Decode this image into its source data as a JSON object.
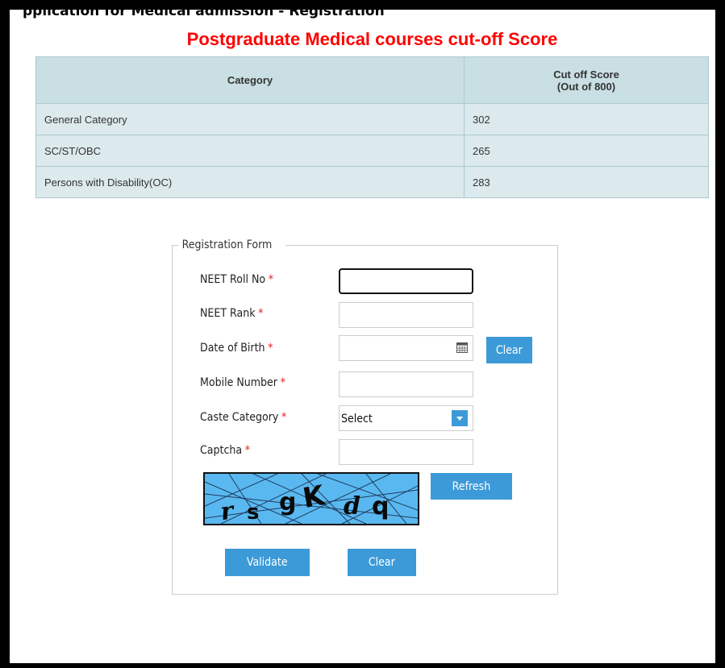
{
  "header": {
    "cropped_title": "pplication for Medical admission - Registration"
  },
  "page_title": "Postgraduate Medical courses cut-off Score",
  "cutoff_table": {
    "headers": {
      "category": "Category",
      "score_line1": "Cut off Score",
      "score_line2": "(Out of 800)"
    },
    "rows": [
      {
        "category": "General Category",
        "score": "302"
      },
      {
        "category": "SC/ST/OBC",
        "score": "265"
      },
      {
        "category": "Persons with Disability(OC)",
        "score": "283"
      }
    ]
  },
  "form": {
    "legend": "Registration Form",
    "required_marker": "*",
    "fields": {
      "roll_no": {
        "label": "NEET Roll No",
        "value": ""
      },
      "rank": {
        "label": "NEET Rank",
        "value": ""
      },
      "dob": {
        "label": "Date of Birth",
        "value": "",
        "icon": "calendar-icon"
      },
      "mobile": {
        "label": "Mobile Number",
        "value": ""
      },
      "caste": {
        "label": "Caste Category",
        "selected": "Select"
      },
      "captcha": {
        "label": "Captcha",
        "value": ""
      }
    },
    "captcha_text": "rsgKdq",
    "buttons": {
      "dob_clear": "Clear",
      "refresh": "Refresh",
      "validate": "Validate",
      "clear": "Clear"
    }
  },
  "colors": {
    "title_red": "#ff0000",
    "button_blue": "#3c9ad8",
    "table_header": "#c9dfe3",
    "table_row": "#dceaed",
    "captcha_bg": "#5ab8f0"
  }
}
